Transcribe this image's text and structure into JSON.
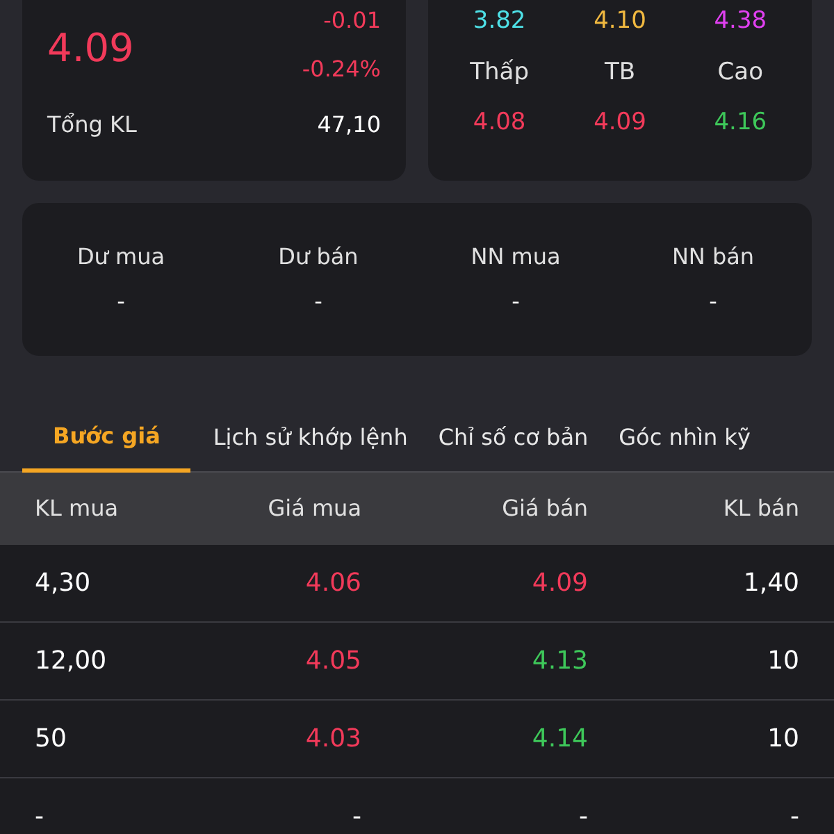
{
  "price_card": {
    "price": {
      "text": "4.09",
      "color": "#f23a5a"
    },
    "change": {
      "text": "-0.01",
      "color": "#f23a5a"
    },
    "change_percent": {
      "text": "-0.24%",
      "color": "#f23a5a"
    },
    "volume_label": "Tổng KL",
    "volume": "47,10"
  },
  "range_card": {
    "top_values": [
      {
        "text": "3.82",
        "color": "#4ee0e6"
      },
      {
        "text": "4.10",
        "color": "#f0b840"
      },
      {
        "text": "4.38",
        "color": "#e040f0"
      }
    ],
    "labels": [
      "Thấp",
      "TB",
      "Cao"
    ],
    "values": [
      {
        "text": "4.08",
        "color": "#f23a5a"
      },
      {
        "text": "4.09",
        "color": "#f23a5a"
      },
      {
        "text": "4.16",
        "color": "#3ec85a"
      }
    ]
  },
  "foreign_card": [
    {
      "label": "Dư mua",
      "value": "-"
    },
    {
      "label": "Dư bán",
      "value": "-"
    },
    {
      "label": "NN mua",
      "value": "-"
    },
    {
      "label": "NN bán",
      "value": "-"
    }
  ],
  "tabs": [
    {
      "label": "Bước giá",
      "selected": true
    },
    {
      "label": "Lịch sử khớp lệnh",
      "selected": false
    },
    {
      "label": "Chỉ số cơ bản",
      "selected": false
    },
    {
      "label": "Góc nhìn kỹ",
      "selected": false
    }
  ],
  "table": {
    "columns": [
      "KL mua",
      "Giá mua",
      "Giá bán",
      "KL bán"
    ],
    "rows": [
      {
        "bid_volume": "4,30",
        "bid_price": {
          "text": "4.06",
          "color": "#f23a5a"
        },
        "ask_price": {
          "text": "4.09",
          "color": "#f23a5a"
        },
        "ask_volume": "1,40"
      },
      {
        "bid_volume": "12,00",
        "bid_price": {
          "text": "4.05",
          "color": "#f23a5a"
        },
        "ask_price": {
          "text": "4.13",
          "color": "#3ec85a"
        },
        "ask_volume": "10"
      },
      {
        "bid_volume": "50",
        "bid_price": {
          "text": "4.03",
          "color": "#f23a5a"
        },
        "ask_price": {
          "text": "4.14",
          "color": "#3ec85a"
        },
        "ask_volume": "10"
      },
      {
        "bid_volume": "-",
        "bid_price": {
          "text": "-",
          "color": "#ffffff"
        },
        "ask_price": {
          "text": "-",
          "color": "#ffffff"
        },
        "ask_volume": "-"
      }
    ]
  }
}
